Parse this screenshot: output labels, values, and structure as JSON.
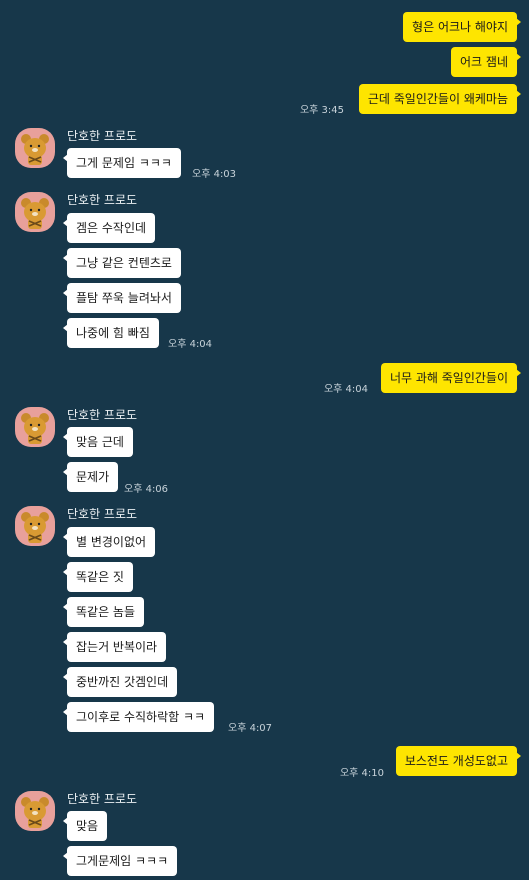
{
  "colors": {
    "background": "#17374a",
    "outgoing_bubble": "#fee500",
    "incoming_bubble": "#ffffff",
    "avatar_bg": "#e8a09b"
  },
  "sender_name": "단호한 프로도",
  "messages": {
    "o1": "형은 어크나 해야지",
    "o2": "어크 잼네",
    "o3": "근데 죽일인간들이 왜케마늠",
    "o3_time": "오후 3:45",
    "g1_m1": "그게 문제임 ㅋㅋㅋ",
    "g1_time": "오후 4:03",
    "g2_m1": "겜은 수작인데",
    "g2_m2": "그냥 같은 컨텐츠로",
    "g2_m3": "플탐 쭈욱 늘려놔서",
    "g2_m4": "나중에 힘 빠짐",
    "g2_time": "오후 4:04",
    "o4": "너무 과해 죽일인간들이",
    "o4_time": "오후 4:04",
    "g3_m1": "맞음 근데",
    "g3_m2": "문제가",
    "g3_time": "오후 4:06",
    "g4_m1": "별 변경이없어",
    "g4_m2": "똑같은 짓",
    "g4_m3": "똑같은 놈들",
    "g4_m4": "잡는거 반복이라",
    "g4_m5": "중반까진 갓겜인데",
    "g4_m6": "그이후로 수직하락함 ㅋㅋ",
    "g4_time": "오후 4:07",
    "o5": "보스전도 개성도없고",
    "o5_time": "오후 4:10",
    "g5_m1": "맞음",
    "g5_m2": "그게문제임 ㅋㅋㅋ"
  },
  "icons": {
    "avatar": "ryan-character-icon"
  }
}
